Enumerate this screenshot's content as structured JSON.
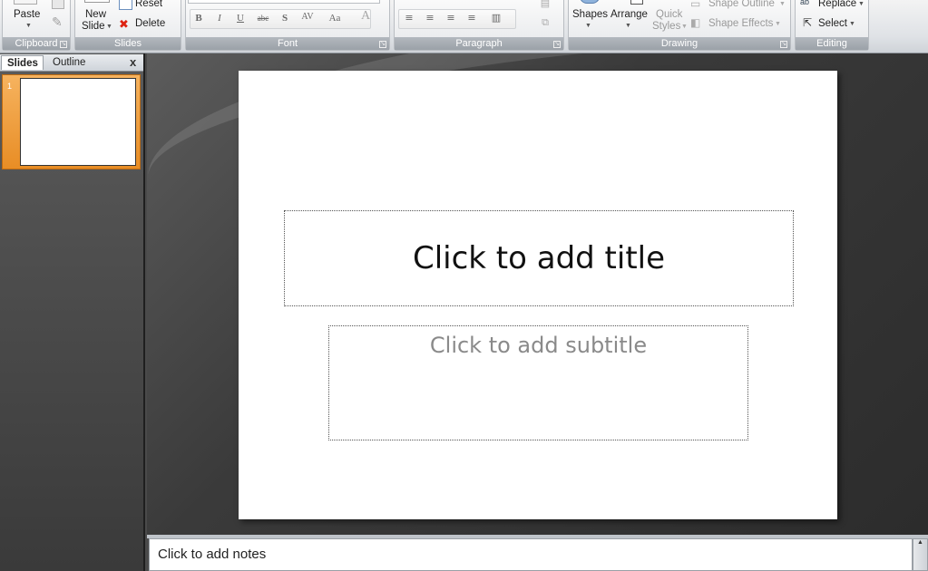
{
  "ribbon": {
    "clipboard": {
      "label": "Clipboard",
      "paste": "Paste"
    },
    "slides": {
      "label": "Slides",
      "new_slide_line1": "New",
      "new_slide_line2": "Slide",
      "reset": "Reset",
      "delete": "Delete"
    },
    "font": {
      "label": "Font",
      "bold": "B",
      "italic": "I",
      "underline": "U",
      "strike": "abc",
      "shadow": "S",
      "spacing": "AV",
      "case": "Aa",
      "color": "A"
    },
    "paragraph": {
      "label": "Paragraph"
    },
    "drawing": {
      "label": "Drawing",
      "shapes": "Shapes",
      "arrange": "Arrange",
      "quick_styles_1": "Quick",
      "quick_styles_2": "Styles",
      "shape_outline": "Shape Outline",
      "shape_effects": "Shape Effects"
    },
    "editing": {
      "label": "Editing",
      "replace": "Replace",
      "select": "Select"
    }
  },
  "pane": {
    "tab_slides": "Slides",
    "tab_outline": "Outline",
    "close": "x",
    "thumbnail_number": "1"
  },
  "slide": {
    "title_placeholder": "Click to add title",
    "subtitle_placeholder": "Click to add subtitle"
  },
  "notes": {
    "placeholder": "Click to add notes"
  }
}
